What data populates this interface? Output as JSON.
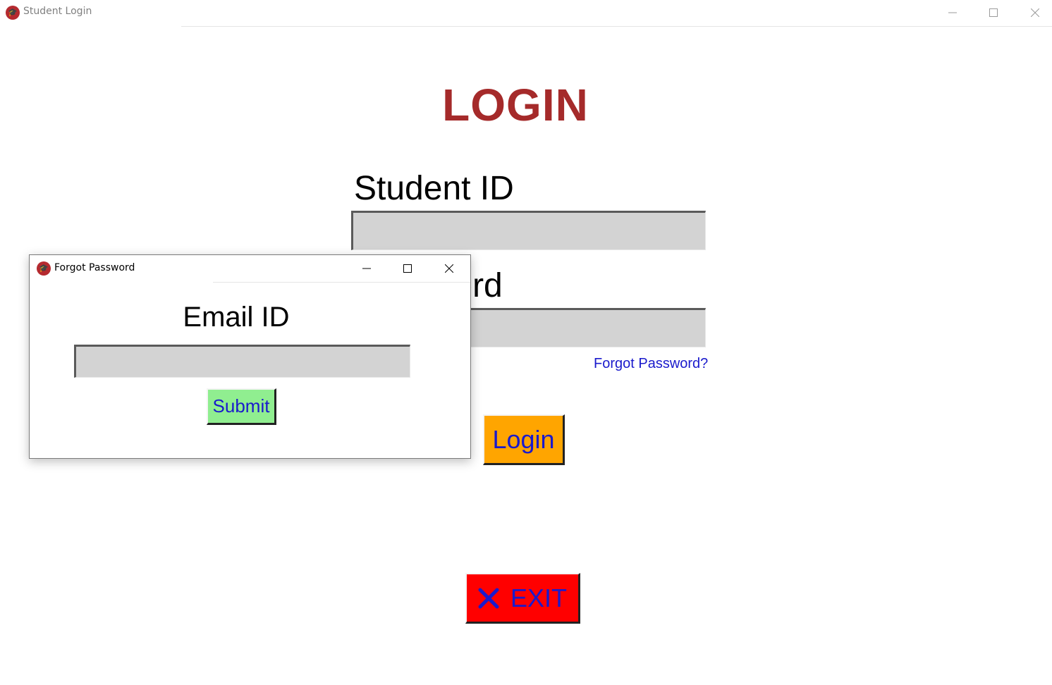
{
  "main_window": {
    "title": "Student Login",
    "app_icon": "graduation-cap-icon",
    "controls": [
      "minimize-icon",
      "maximize-icon",
      "close-icon"
    ]
  },
  "login_form": {
    "heading": "LOGIN",
    "student_id_label": "Student ID",
    "student_id_value": "",
    "password_label": "Password",
    "password_value": "",
    "forgot_link": "Forgot Password?",
    "login_button": "Login",
    "exit_button": "EXIT",
    "exit_icon": "x-icon"
  },
  "forgot_dialog": {
    "title": "Forgot Password",
    "app_icon": "graduation-cap-icon",
    "email_label": "Email ID",
    "email_value": "",
    "submit_button": "Submit"
  },
  "colors": {
    "heading": "#a52a2a",
    "link_and_button_text": "#1a1acc",
    "login_button_bg": "#ffa500",
    "exit_button_bg": "#ff0000",
    "submit_button_bg": "#90ee90",
    "entry_bg": "#d3d3d3",
    "app_icon_bg": "#b52a2f"
  }
}
